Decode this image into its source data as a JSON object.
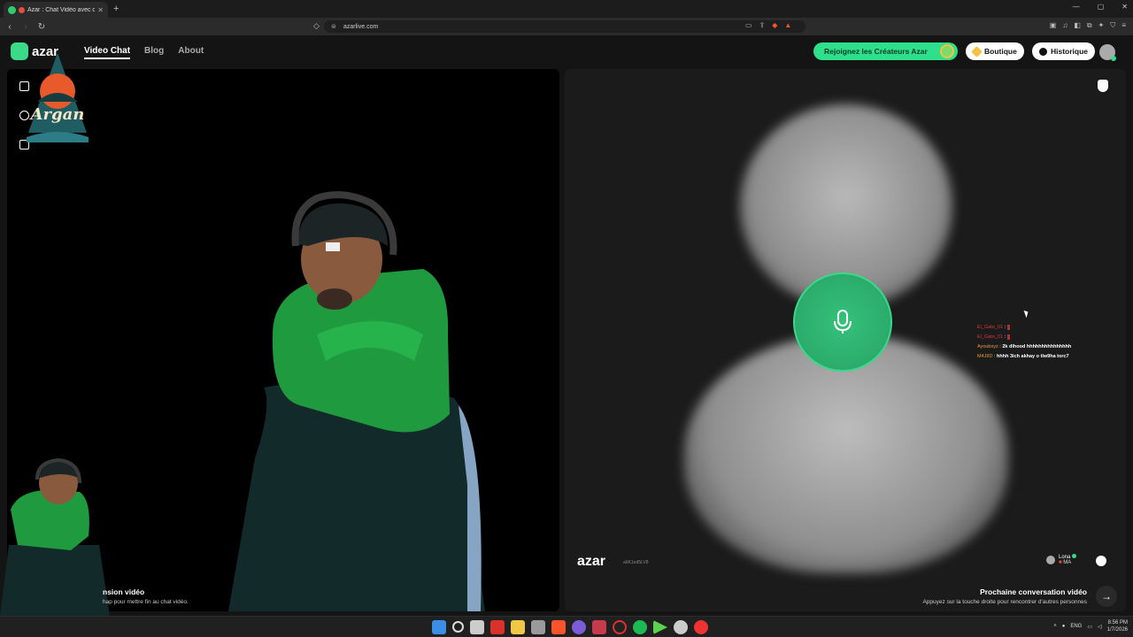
{
  "browser": {
    "tab_title": "Azar : Chat Vidéo avec de no",
    "tab_close": "✕",
    "new_tab": "+",
    "url": "azarlive.com",
    "window_controls": [
      "—",
      "▢",
      "✕"
    ]
  },
  "site": {
    "logo_text": "azar",
    "nav": [
      "Video Chat",
      "Blog",
      "About"
    ],
    "creators_button": "Rejoignez les Créateurs Azar",
    "shop_button": "Boutique",
    "history_button": "Historique"
  },
  "remote": {
    "watermark": "azar",
    "id": "a6K1ed5LV8",
    "user_name": "Lona",
    "user_country": "MA"
  },
  "stream_chat": [
    {
      "name": "El_Gato_01",
      "text": ""
    },
    {
      "name": "El_Gato_01",
      "text": ""
    },
    {
      "name": "Ayoubxyz",
      "text": "2k dlhood hhhhhhhhhhhhhhh"
    },
    {
      "name": "M4JIID",
      "text": "hhhh 3ich akhay o tlw9ha torc7"
    }
  ],
  "bottom": {
    "left_title": "nsion vidéo",
    "left_sub": "hap pour mettre fin au chat vidéo.",
    "right_title": "Prochaine conversation vidéo",
    "right_sub": "Appuyez sur la touche droite pour rencontrer d'autres personnes",
    "next_arrow": "→"
  },
  "taskbar": {
    "lang": "ENG",
    "time": "8:56 PM",
    "date": "1/7/2026"
  },
  "colors": {
    "brand_green": "#2ee08c",
    "mic_green": "#2fb36f"
  },
  "overlay_text": {
    "argan": "Argan"
  }
}
